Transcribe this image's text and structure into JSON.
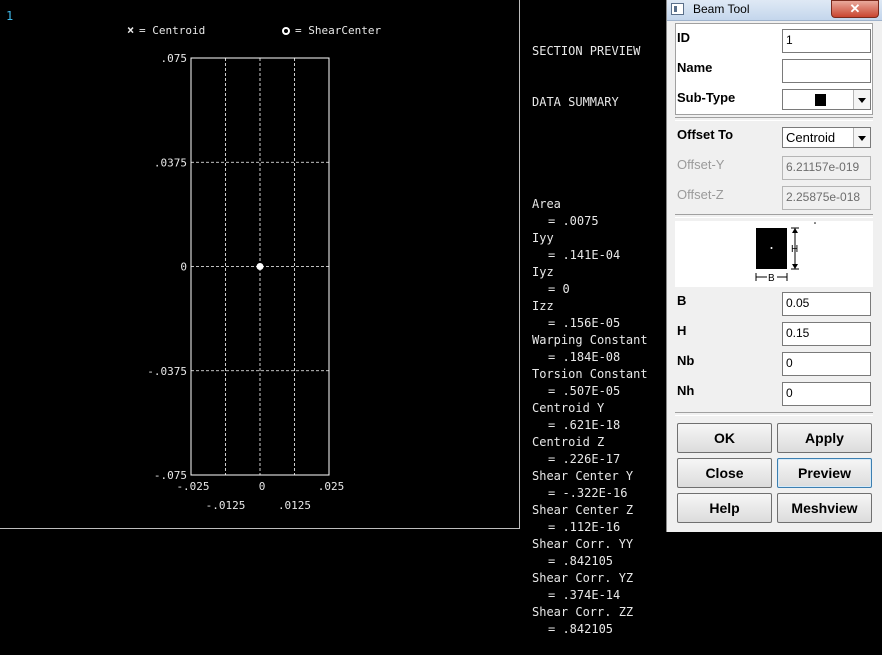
{
  "preview": {
    "window_number": "1",
    "legend": {
      "centroid": "= Centroid",
      "shear_center": "= ShearCenter"
    }
  },
  "chart_data": {
    "type": "scatter",
    "x_ticks_row1": [
      "-.025",
      "0",
      ".025"
    ],
    "x_ticks_row2": [
      "-.0125",
      ".0125"
    ],
    "y_ticks": [
      ".075",
      ".0375",
      "0",
      "-.0375",
      "-.075"
    ],
    "xlim": [
      -0.025,
      0.025
    ],
    "ylim": [
      -0.075,
      0.075
    ],
    "grid": true,
    "points": [
      {
        "name": "ShearCenter",
        "x": 0,
        "y": 0
      }
    ]
  },
  "summary": {
    "header1": "SECTION PREVIEW",
    "header2": "DATA SUMMARY",
    "rows": [
      {
        "label": "Area",
        "value": "= .0075"
      },
      {
        "label": "Iyy",
        "value": "= .141E-04"
      },
      {
        "label": "Iyz",
        "value": "= 0"
      },
      {
        "label": "Izz",
        "value": "= .156E-05"
      },
      {
        "label": "Warping Constant",
        "value": "= .184E-08"
      },
      {
        "label": "Torsion Constant",
        "value": "= .507E-05"
      },
      {
        "label": "Centroid Y",
        "value": "= .621E-18"
      },
      {
        "label": "Centroid Z",
        "value": "= .226E-17"
      },
      {
        "label": "Shear Center Y",
        "value": "= -.322E-16"
      },
      {
        "label": "Shear Center Z",
        "value": "= .112E-16"
      },
      {
        "label": "Shear Corr. YY",
        "value": "= .842105"
      },
      {
        "label": "Shear Corr. YZ",
        "value": "= .374E-14"
      },
      {
        "label": "Shear Corr. ZZ",
        "value": "= .842105"
      }
    ]
  },
  "tool": {
    "title": "Beam Tool",
    "close_glyph": "✕",
    "id_label": "ID",
    "id_value": "1",
    "name_label": "Name",
    "name_value": "",
    "subtype_label": "Sub-Type",
    "offset_label": "Offset To",
    "offset_value": "Centroid",
    "offset_y_label": "Offset-Y",
    "offset_y_value": "6.21157e-019",
    "offset_z_label": "Offset-Z",
    "offset_z_value": "2.25875e-018",
    "diagram": {
      "h": "H",
      "b": "B"
    },
    "b_label": "B",
    "b_value": "0.05",
    "h_label": "H",
    "h_value": "0.15",
    "nb_label": "Nb",
    "nb_value": "0",
    "nh_label": "Nh",
    "nh_value": "0",
    "buttons": {
      "ok": "OK",
      "apply": "Apply",
      "close": "Close",
      "preview": "Preview",
      "help": "Help",
      "meshview": "Meshview"
    }
  }
}
